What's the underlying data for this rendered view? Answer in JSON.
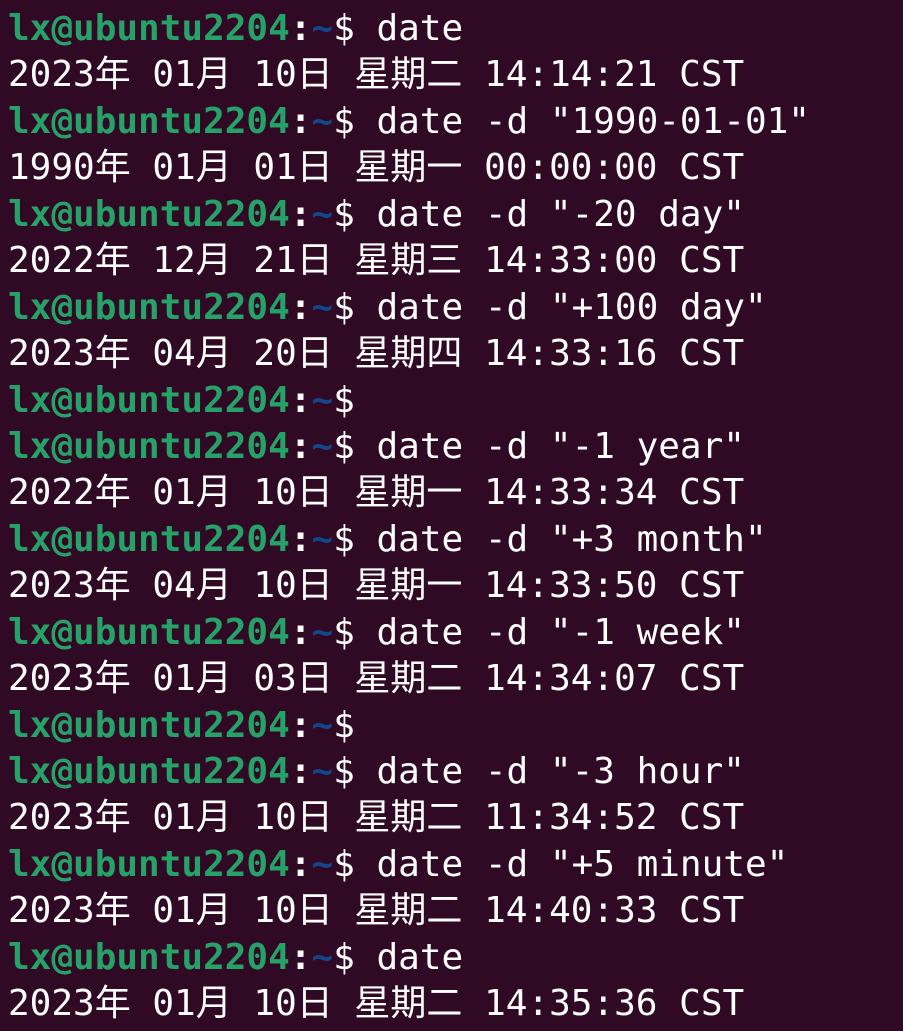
{
  "theme": {
    "background": "#300a24",
    "foreground": "#ffffff",
    "prompt_user_color": "#26a269",
    "prompt_path_color": "#12488b"
  },
  "prompt": {
    "user_host": "lx@ubuntu2204",
    "separator": ":",
    "path": "~",
    "symbol": "$ "
  },
  "lines": [
    {
      "type": "prompt",
      "command": "date"
    },
    {
      "type": "output",
      "text": "2023年 01月 10日 星期二 14:14:21 CST"
    },
    {
      "type": "prompt",
      "command": "date -d \"1990-01-01\""
    },
    {
      "type": "output",
      "text": "1990年 01月 01日 星期一 00:00:00 CST"
    },
    {
      "type": "prompt",
      "command": "date -d \"-20 day\""
    },
    {
      "type": "output",
      "text": "2022年 12月 21日 星期三 14:33:00 CST"
    },
    {
      "type": "prompt",
      "command": "date -d \"+100 day\""
    },
    {
      "type": "output",
      "text": "2023年 04月 20日 星期四 14:33:16 CST"
    },
    {
      "type": "prompt",
      "command": ""
    },
    {
      "type": "prompt",
      "command": "date -d \"-1 year\""
    },
    {
      "type": "output",
      "text": "2022年 01月 10日 星期一 14:33:34 CST"
    },
    {
      "type": "prompt",
      "command": "date -d \"+3 month\""
    },
    {
      "type": "output",
      "text": "2023年 04月 10日 星期一 14:33:50 CST"
    },
    {
      "type": "prompt",
      "command": "date -d \"-1 week\""
    },
    {
      "type": "output",
      "text": "2023年 01月 03日 星期二 14:34:07 CST"
    },
    {
      "type": "prompt",
      "command": ""
    },
    {
      "type": "prompt",
      "command": "date -d \"-3 hour\""
    },
    {
      "type": "output",
      "text": "2023年 01月 10日 星期二 11:34:52 CST"
    },
    {
      "type": "prompt",
      "command": "date -d \"+5 minute\""
    },
    {
      "type": "output",
      "text": "2023年 01月 10日 星期二 14:40:33 CST"
    },
    {
      "type": "prompt",
      "command": "date"
    },
    {
      "type": "output",
      "text": "2023年 01月 10日 星期二 14:35:36 CST"
    }
  ]
}
